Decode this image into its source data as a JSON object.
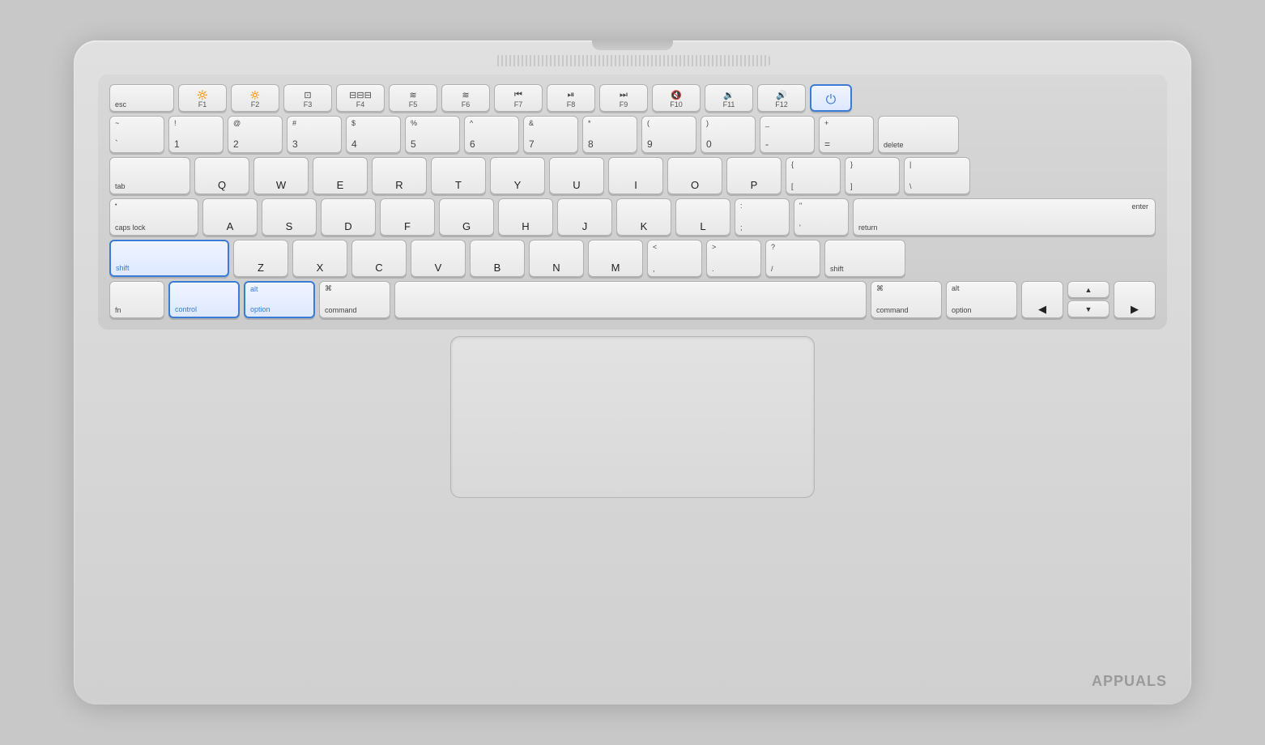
{
  "keyboard": {
    "rows": {
      "fn": {
        "keys": [
          {
            "id": "esc",
            "label": "esc"
          },
          {
            "id": "f1",
            "topIcon": "☀",
            "bottomLabel": "F1"
          },
          {
            "id": "f2",
            "topIcon": "☀",
            "bottomLabel": "F2"
          },
          {
            "id": "f3",
            "topIcon": "⊞",
            "bottomLabel": "F3"
          },
          {
            "id": "f4",
            "topIcon": "⊞⊞⊞",
            "bottomLabel": "F4"
          },
          {
            "id": "f5",
            "topIcon": "≋",
            "bottomLabel": "F5"
          },
          {
            "id": "f6",
            "topIcon": "≋",
            "bottomLabel": "F6"
          },
          {
            "id": "f7",
            "topIcon": "⏮",
            "bottomLabel": "F7"
          },
          {
            "id": "f8",
            "topIcon": "⏯",
            "bottomLabel": "F8"
          },
          {
            "id": "f9",
            "topIcon": "⏭",
            "bottomLabel": "F9"
          },
          {
            "id": "f10",
            "topIcon": "🔇",
            "bottomLabel": "F10"
          },
          {
            "id": "f11",
            "topIcon": "🔉",
            "bottomLabel": "F11"
          },
          {
            "id": "f12",
            "topIcon": "🔊",
            "bottomLabel": "F12"
          },
          {
            "id": "power",
            "label": "⏻",
            "highlighted": true
          }
        ]
      }
    },
    "highlighted_keys": [
      "shift-l",
      "control",
      "option-l"
    ],
    "power_label": "⏻",
    "watermark": "APPUALS"
  }
}
